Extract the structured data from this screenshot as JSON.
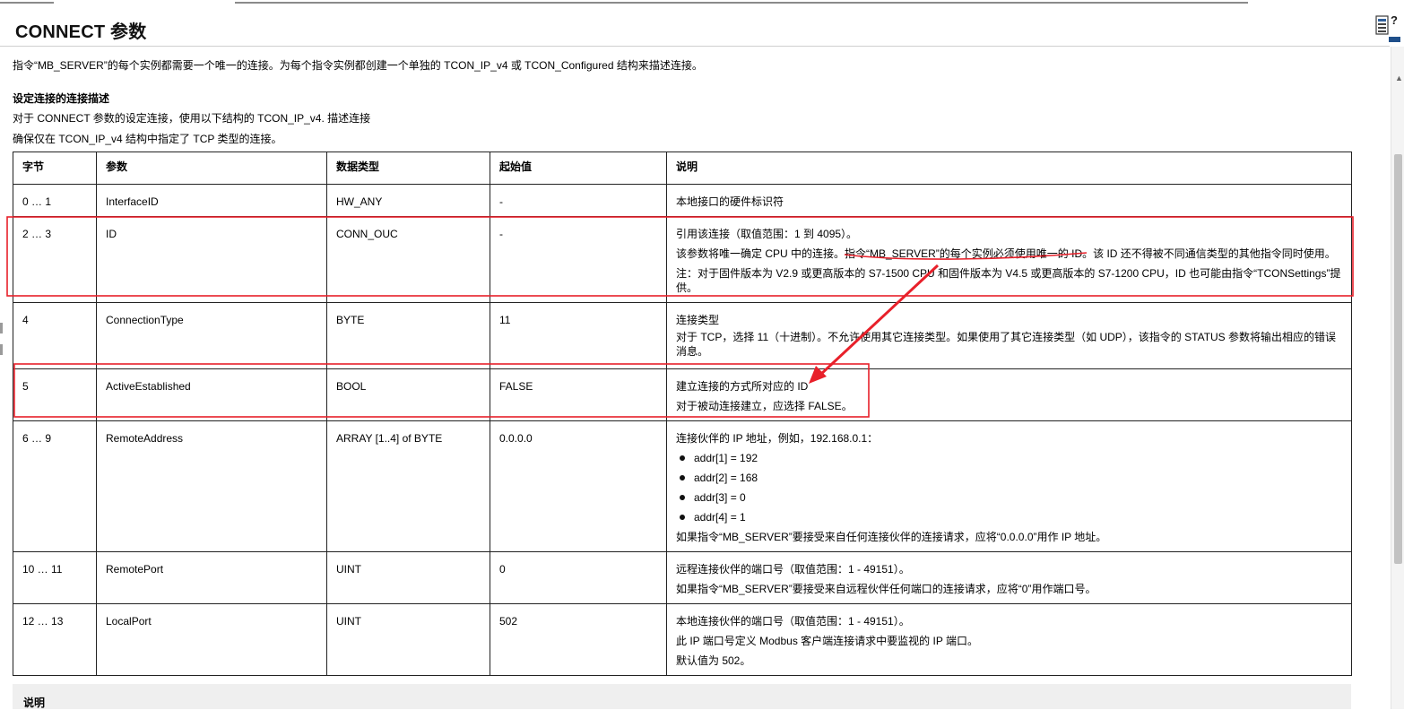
{
  "header": {
    "title": "CONNECT 参数"
  },
  "intro": "指令“MB_SERVER”的每个实例都需要一个唯一的连接。为每个指令实例都创建一个单独的 TCON_IP_v4 或 TCON_Configured 结构来描述连接。",
  "section": {
    "heading": "设定连接的连接描述",
    "line1": "对于 CONNECT 参数的设定连接，使用以下结构的 TCON_IP_v4. 描述连接",
    "line2": "确保仅在 TCON_IP_v4 结构中指定了 TCP 类型的连接。"
  },
  "table": {
    "headers": [
      "字节",
      "参数",
      "数据类型",
      "起始值",
      "说明"
    ],
    "rows": [
      {
        "byte": "0 … 1",
        "param": "InterfaceID",
        "type": "HW_ANY",
        "start": "-",
        "desc": [
          "本地接口的硬件标识符"
        ]
      },
      {
        "byte": "2 … 3",
        "param": "ID",
        "type": "CONN_OUC",
        "start": "-",
        "desc": [
          "引用该连接（取值范围：1 到 4095）。",
          "该参数将唯一确定 CPU 中的连接。指令“MB_SERVER”的每个实例必须使用唯一的 ID。该 ID 还不得被不同通信类型的其他指令同时使用。",
          "注：对于固件版本为 V2.9 或更高版本的 S7-1500 CPU 和固件版本为 V4.5 或更高版本的 S7-1200 CPU，ID 也可能由指令“TCONSettings”提供。"
        ]
      },
      {
        "byte": "4",
        "param": "ConnectionType",
        "type": "BYTE",
        "start": "11",
        "desc": [
          "连接类型",
          "对于 TCP，选择 11（十进制）。不允许使用其它连接类型。如果使用了其它连接类型（如 UDP），该指令的 STATUS 参数将输出相应的错误消息。"
        ]
      },
      {
        "byte": "5",
        "param": "ActiveEstablished",
        "type": "BOOL",
        "start": "FALSE",
        "desc": [
          "建立连接的方式所对应的 ID",
          "对于被动连接建立，应选择 FALSE。"
        ]
      },
      {
        "byte": "6 … 9",
        "param": "RemoteAddress",
        "type": "ARRAY [1..4] of BYTE",
        "start": "0.0.0.0",
        "desc": [
          "连接伙伴的 IP 地址，例如，192.168.0.1："
        ],
        "bullets": [
          "addr[1] = 192",
          "addr[2] = 168",
          "addr[3] = 0",
          "addr[4] = 1"
        ],
        "after": "如果指令“MB_SERVER”要接受来自任何连接伙伴的连接请求，应将“0.0.0.0”用作 IP 地址。"
      },
      {
        "byte": "10 … 11",
        "param": "RemotePort",
        "type": "UINT",
        "start": "0",
        "desc": [
          "远程连接伙伴的端口号（取值范围：1 - 49151）。",
          "如果指令“MB_SERVER”要接受来自远程伙伴任何端口的连接请求，应将“0”用作端口号。"
        ]
      },
      {
        "byte": "12 … 13",
        "param": "LocalPort",
        "type": "UINT",
        "start": "502",
        "desc": [
          "本地连接伙伴的端口号（取值范围：1 - 49151）。",
          "此 IP 端口号定义 Modbus 客户端连接请求中要监视的 IP 端口。",
          "默认值为 502。"
        ]
      }
    ]
  },
  "note": {
    "label": "说明"
  },
  "colors": {
    "highlight": "#e8202a",
    "border": "#222222",
    "note_background": "#efefef"
  },
  "icons": {
    "help": "help-icon"
  }
}
